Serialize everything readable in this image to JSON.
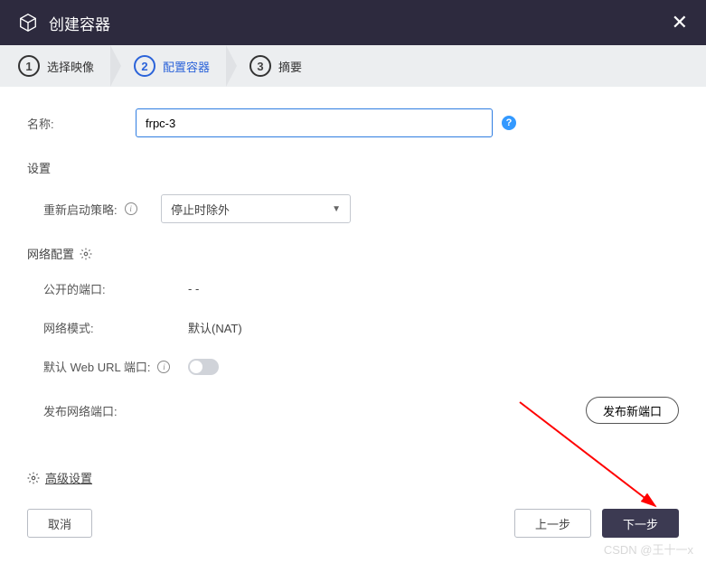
{
  "header": {
    "title": "创建容器"
  },
  "steps": [
    {
      "num": "1",
      "label": "选择映像"
    },
    {
      "num": "2",
      "label": "配置容器"
    },
    {
      "num": "3",
      "label": "摘要"
    }
  ],
  "form": {
    "name_label": "名称:",
    "name_value": "frpc-3"
  },
  "settings": {
    "title": "设置",
    "restart_label": "重新启动策略:",
    "restart_value": "停止时除外"
  },
  "network": {
    "title": "网络配置",
    "ports_label": "公开的端口:",
    "ports_value": "- -",
    "mode_label": "网络模式:",
    "mode_value": "默认(NAT)",
    "weburl_label": "默认 Web URL 端口:",
    "publish_label": "发布网络端口:",
    "publish_btn": "发布新端口"
  },
  "advanced": "高级设置",
  "footer": {
    "cancel": "取消",
    "prev": "上一步",
    "next": "下一步"
  },
  "watermark": "CSDN @王十一x"
}
